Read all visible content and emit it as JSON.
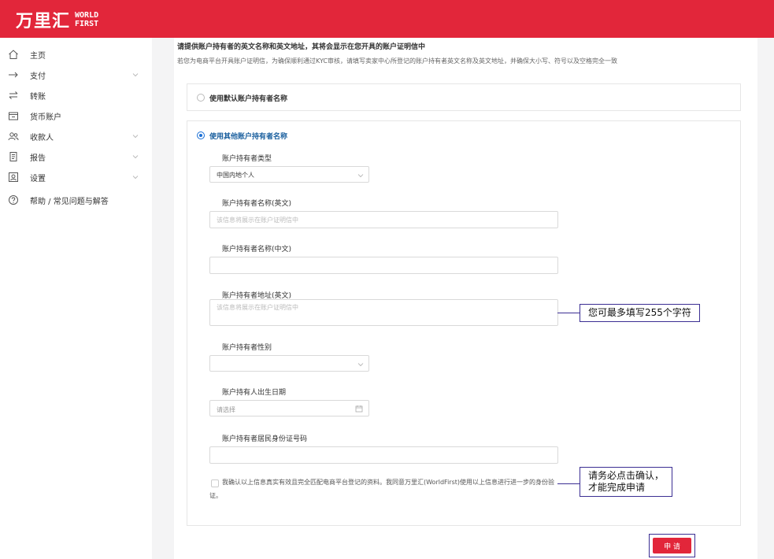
{
  "brand": {
    "cn": "万里汇",
    "en_line1": "WORLD",
    "en_line2": "FIRST"
  },
  "sidebar": {
    "items": [
      {
        "label": "主页",
        "icon": "home-icon",
        "expandable": false
      },
      {
        "label": "支付",
        "icon": "arrow-right-icon",
        "expandable": true
      },
      {
        "label": "转账",
        "icon": "transfer-icon",
        "expandable": false
      },
      {
        "label": "货币账户",
        "icon": "currency-account-icon",
        "expandable": false
      },
      {
        "label": "收款人",
        "icon": "payees-icon",
        "expandable": true
      },
      {
        "label": "报告",
        "icon": "report-icon",
        "expandable": true
      },
      {
        "label": "设置",
        "icon": "settings-icon",
        "expandable": true
      },
      {
        "label": "帮助 / 常见问题与解答",
        "icon": "help-icon",
        "expandable": false
      }
    ]
  },
  "intro": {
    "title": "请提供账户持有者的英文名称和英文地址，其将会显示在您开具的账户证明信中",
    "description": "若您为电商平台开具账户证明信，为确保顺利通过KYC审核，请填写卖家中心所登记的账户持有者英文名称及英文地址，并确保大小写、符号以及空格完全一致"
  },
  "options": {
    "default_name": "使用默认账户持有者名称",
    "other_name": "使用其他账户持有者名称"
  },
  "form": {
    "holder_type": {
      "label": "账户持有者类型",
      "value": "中国内地个人"
    },
    "name_en": {
      "label": "账户持有者名称(英文)",
      "placeholder": "该信息将展示在账户证明信中"
    },
    "name_cn": {
      "label": "账户持有者名称(中文)",
      "placeholder": ""
    },
    "address_en": {
      "label": "账户持有者地址(英文)",
      "placeholder": "该信息将展示在账户证明信中"
    },
    "gender": {
      "label": "账户持有者性别",
      "value": ""
    },
    "birth_date": {
      "label": "账户持有人出生日期",
      "placeholder": "请选择"
    },
    "id_number": {
      "label": "账户持有者居民身份证号码",
      "placeholder": ""
    },
    "consent": "我确认以上信息真实有效且完全匹配电商平台登记的资料。我同意万里汇(WorldFirst)使用以上信息进行进一步的身份验证。"
  },
  "callouts": {
    "max_chars": "您可最多填写255个字符",
    "confirm_line1": "请务必点击确认，",
    "confirm_line2": "才能完成申请"
  },
  "submit_label": "申 请",
  "colors": {
    "brand_red": "#e2263a",
    "annotation_purple": "#3b2e93",
    "radio_blue": "#1a6fd6",
    "option_title_blue": "#1a5f9e"
  }
}
